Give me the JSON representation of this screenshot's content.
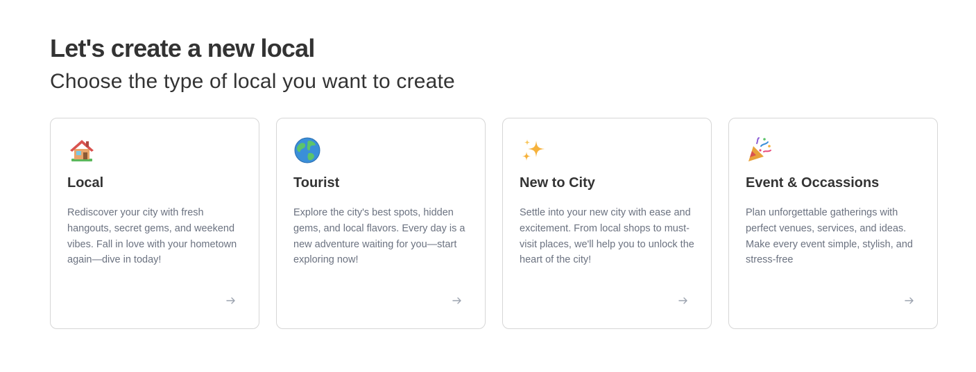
{
  "header": {
    "title": "Let's create a new local",
    "subtitle": "Choose the type of local you want to create"
  },
  "cards": [
    {
      "icon": "house-icon",
      "title": "Local",
      "description": "Rediscover your city with fresh hangouts, secret gems, and weekend vibes. Fall in love with your hometown again—dive in today!"
    },
    {
      "icon": "globe-icon",
      "title": "Tourist",
      "description": "Explore the city's best spots, hidden gems, and local flavors. Every day is a new adventure waiting for you—start exploring now!"
    },
    {
      "icon": "sparkles-icon",
      "title": "New to City",
      "description": "Settle into your new city with ease and excitement. From local shops to must-visit places, we'll help you to unlock the heart of the city!"
    },
    {
      "icon": "party-popper-icon",
      "title": "Event & Occassions",
      "description": "Plan unforgettable gatherings with perfect venues, services, and ideas. Make every event simple, stylish, and stress-free"
    }
  ],
  "colors": {
    "text": "#333333",
    "muted_text": "#6b7280",
    "card_border": "#d6d6d6",
    "arrow": "#9ca3af"
  }
}
